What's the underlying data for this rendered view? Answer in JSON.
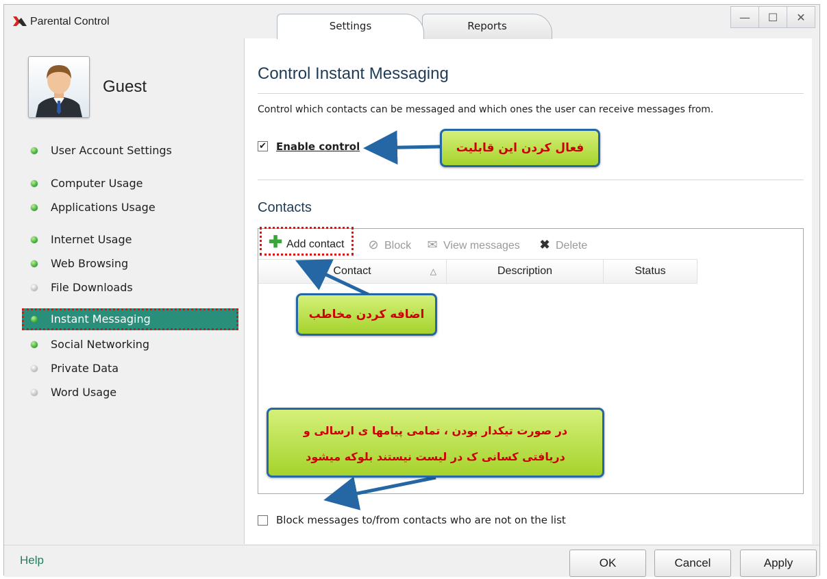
{
  "window": {
    "title": "Parental Control",
    "controls": {
      "minimize": "—",
      "maximize": "☐",
      "close": "✕"
    }
  },
  "tabs": [
    {
      "label": "Settings",
      "active": true
    },
    {
      "label": "Reports",
      "active": false
    }
  ],
  "user": {
    "name": "Guest"
  },
  "sidebar": {
    "items": [
      {
        "label": "User Account Settings",
        "status": "on"
      },
      {
        "label": "Computer Usage",
        "status": "on"
      },
      {
        "label": "Applications Usage",
        "status": "on"
      },
      {
        "label": "Internet Usage",
        "status": "on"
      },
      {
        "label": "Web Browsing",
        "status": "on"
      },
      {
        "label": "File Downloads",
        "status": "off"
      },
      {
        "label": "Instant Messaging",
        "status": "on",
        "selected": true
      },
      {
        "label": "Social Networking",
        "status": "on"
      },
      {
        "label": "Private Data",
        "status": "off"
      },
      {
        "label": "Word Usage",
        "status": "off"
      }
    ]
  },
  "main": {
    "title": "Control Instant Messaging",
    "description": "Control which contacts can be messaged and which ones the user can receive messages from.",
    "enable_control": {
      "label": "Enable control",
      "checked": true
    },
    "contacts_title": "Contacts",
    "toolbar": {
      "add": "Add contact",
      "block": "Block",
      "view": "View messages",
      "delete": "Delete"
    },
    "columns": [
      "Contact",
      "Description",
      "Status"
    ],
    "sort_indicator": "△",
    "block_unlisted": {
      "label": "Block messages to/from contacts who are not on the list",
      "checked": false
    }
  },
  "annotations": {
    "enable": "فعال کردن این قابلیت",
    "add_contact": "اضافه کردن مخاطب",
    "block_line1": "در صورت تیکدار بودن ، تمامی پیامها ی ارسالی و",
    "block_line2": "دریافتی کسانی ک در لیست نیستند بلوکه میشود"
  },
  "footer": {
    "help": "Help",
    "ok": "OK",
    "cancel": "Cancel",
    "apply": "Apply"
  },
  "colors": {
    "selected_item": "#2a8f7a",
    "annotation_bg": "#b5dd3c",
    "annotation_border": "#2467a4",
    "annotation_text": "#cc0000",
    "highlight": "#d11818"
  }
}
